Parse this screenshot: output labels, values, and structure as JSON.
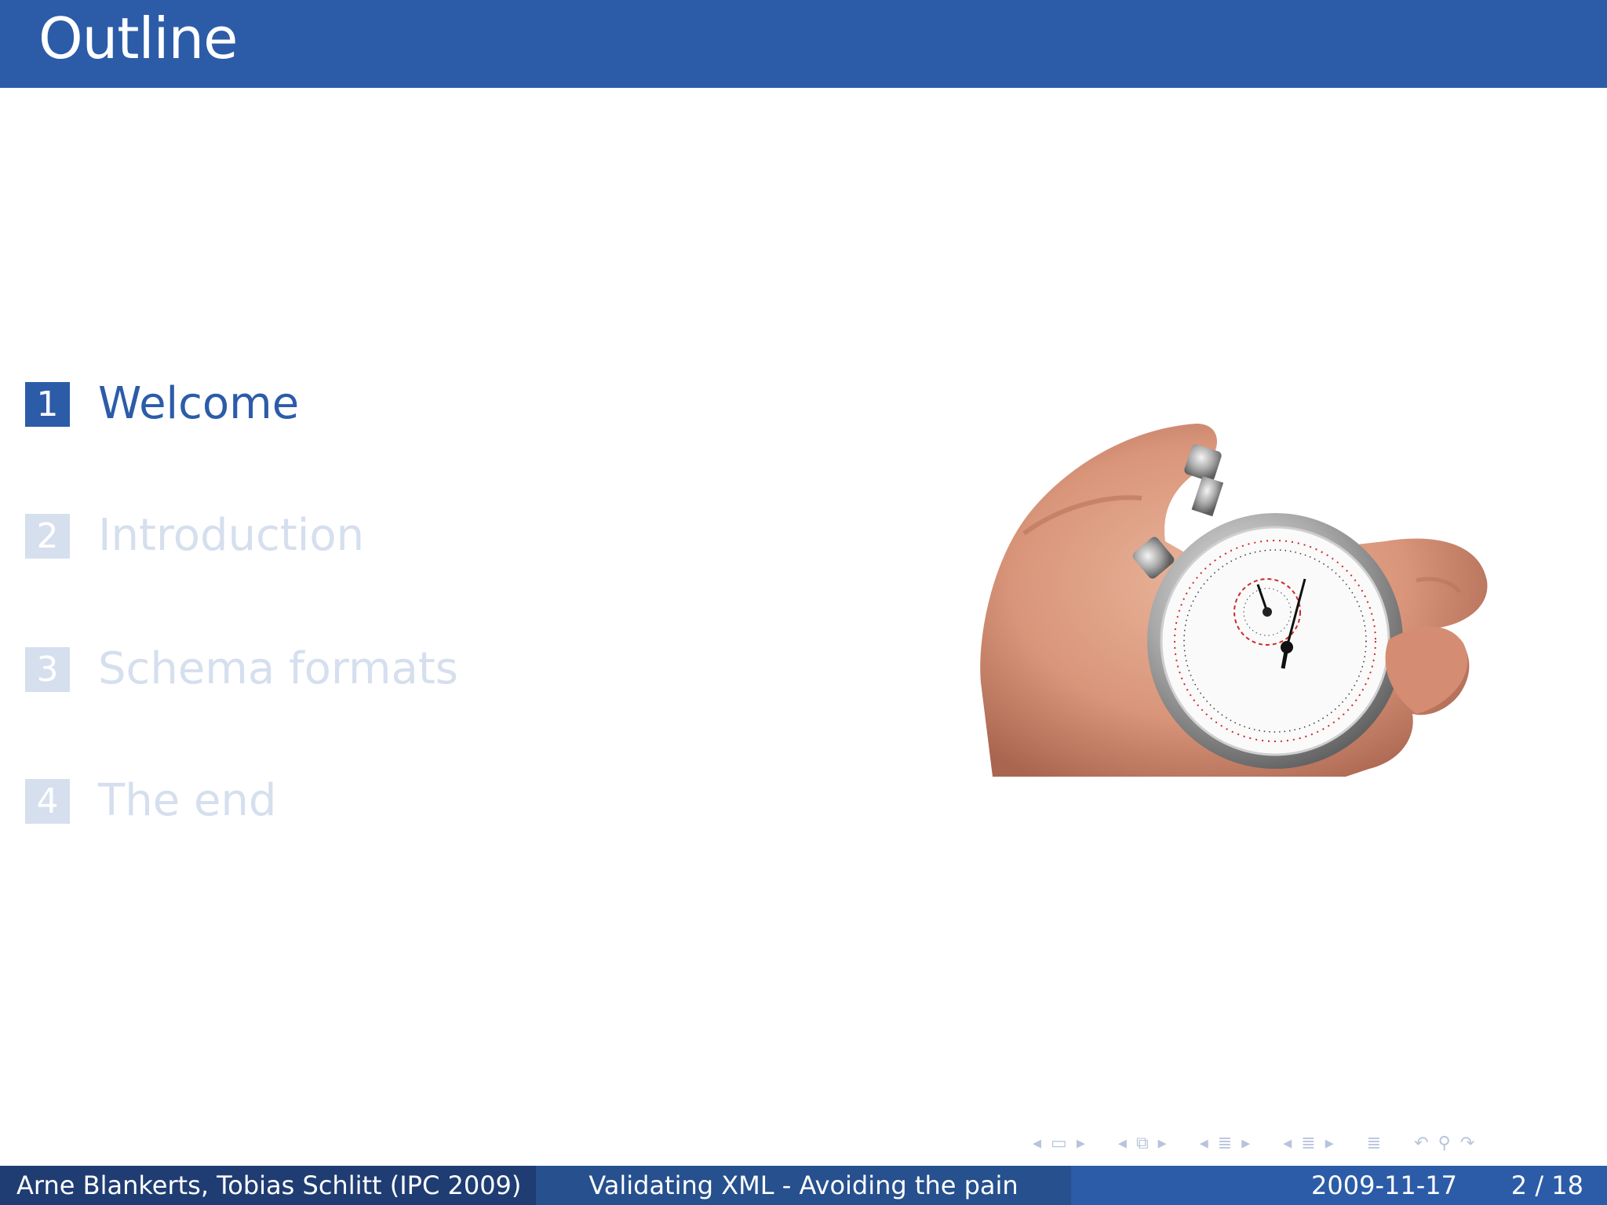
{
  "slide": {
    "title": "Outline"
  },
  "toc": {
    "items": [
      {
        "number": "1",
        "label": "Welcome",
        "active": true
      },
      {
        "number": "2",
        "label": "Introduction",
        "active": false
      },
      {
        "number": "3",
        "label": "Schema formats",
        "active": false
      },
      {
        "number": "4",
        "label": "The end",
        "active": false
      }
    ]
  },
  "image": {
    "subject": "stopwatch-in-hand-photo"
  },
  "nav": {
    "icons": [
      "arrow-left-icon",
      "frame-icon",
      "arrow-right-icon",
      "arrow-left-icon",
      "subsection-icon",
      "arrow-right-icon",
      "arrow-left-icon",
      "section-icon",
      "arrow-right-icon",
      "arrow-left-icon",
      "outline-icon",
      "arrow-right-icon",
      "outline-icon",
      "undo-icon",
      "search-icon",
      "redo-icon"
    ]
  },
  "footer": {
    "author": "Arne Blankerts, Tobias Schlitt  (IPC 2009)",
    "talk_title": "Validating XML - Avoiding the pain",
    "date": "2009-11-17",
    "page": "2 / 18"
  },
  "colors": {
    "accent": "#2c5ca8",
    "dim": "#d5dfee",
    "footer_dark": "#1f3d72",
    "footer_mid": "#26508e"
  }
}
